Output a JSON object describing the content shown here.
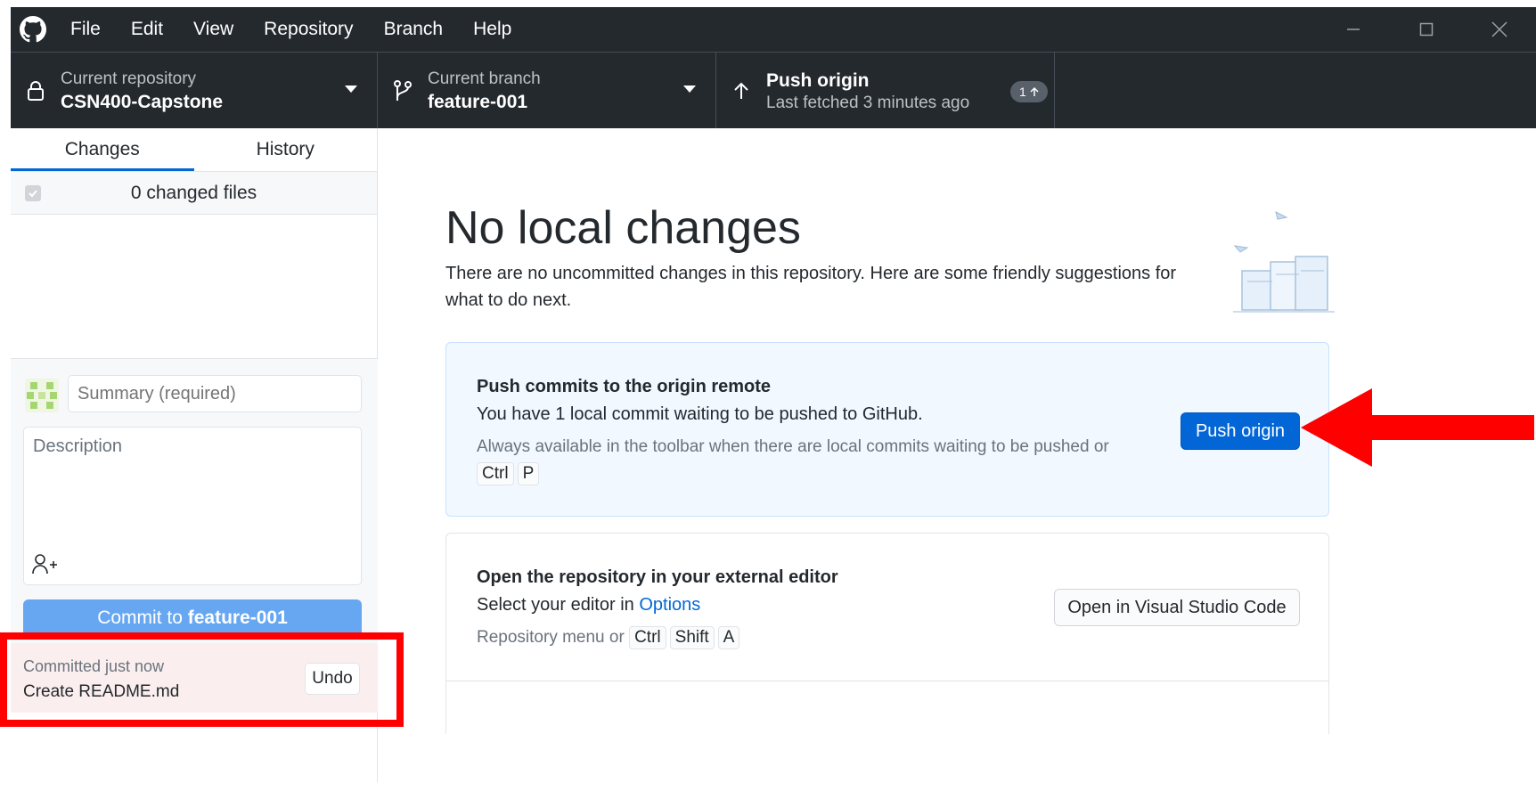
{
  "menu": {
    "items": [
      "File",
      "Edit",
      "View",
      "Repository",
      "Branch",
      "Help"
    ]
  },
  "toolbar": {
    "repo_label": "Current repository",
    "repo_value": "CSN400-Capstone",
    "branch_label": "Current branch",
    "branch_value": "feature-001",
    "push_title": "Push origin",
    "push_subtitle": "Last fetched 3 minutes ago",
    "push_badge_count": "1"
  },
  "sidebar": {
    "tabs": [
      "Changes",
      "History"
    ],
    "active_tab": "Changes",
    "changed_files": "0 changed files",
    "summary_placeholder": "Summary (required)",
    "description_placeholder": "Description",
    "commit_prefix": "Commit to ",
    "commit_branch": "feature-001",
    "undo": {
      "time": "Committed just now",
      "message": "Create README.md",
      "button": "Undo"
    }
  },
  "main": {
    "title": "No local changes",
    "description": "There are no uncommitted changes in this repository. Here are some friendly suggestions for what to do next.",
    "push_card": {
      "title": "Push commits to the origin remote",
      "line": "You have 1 local commit waiting to be pushed to GitHub.",
      "hint": "Always available in the toolbar when there are local commits waiting to be pushed or",
      "keys": [
        "Ctrl",
        "P"
      ],
      "button": "Push origin"
    },
    "editor_card": {
      "title": "Open the repository in your external editor",
      "line_prefix": "Select your editor in ",
      "line_link": "Options",
      "hint_prefix": "Repository menu or",
      "keys": [
        "Ctrl",
        "Shift",
        "A"
      ],
      "button": "Open in Visual Studio Code"
    }
  },
  "colors": {
    "accent": "#0366d6",
    "titlebar": "#24292e",
    "annotation": "#ff0000"
  }
}
